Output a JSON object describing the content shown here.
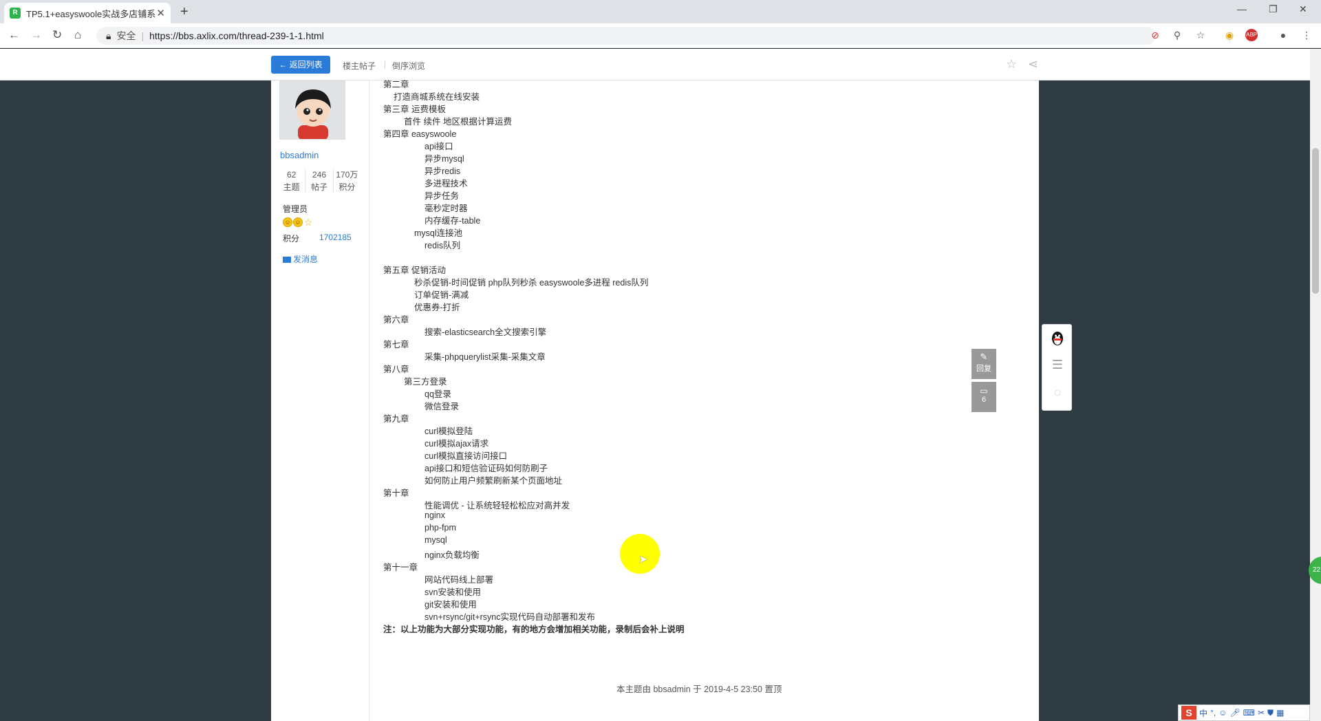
{
  "browser": {
    "tab_title": "TP5.1+easyswoole实战多店铺系",
    "tab_close": "✕",
    "new_tab": "+",
    "security_label": "安全",
    "url": "https://bbs.axlix.com/thread-239-1-1.html",
    "window_minimize": "—",
    "window_restore": "❐",
    "window_close": "✕"
  },
  "header": {
    "back_button": "返回列表",
    "owner_posts": "楼主帖子",
    "reverse_browse": "倒序浏览"
  },
  "author": {
    "username": "bbsadmin",
    "stats": [
      {
        "value": "62",
        "label": "主题"
      },
      {
        "value": "246",
        "label": "帖子"
      },
      {
        "value": "170万",
        "label": "积分"
      }
    ],
    "role": "管理员",
    "points_label": "积分",
    "points_value": "1702185",
    "send_message": "发消息"
  },
  "post": {
    "lines": [
      {
        "text": "第二章",
        "indent": 0
      },
      {
        "text": "打造商城系统在线安装",
        "indent": 1
      },
      {
        "text": "第三章 运费模板",
        "indent": 0
      },
      {
        "text": "首件 续件 地区根据计算运费",
        "indent": 2
      },
      {
        "text": "第四章  easyswoole",
        "indent": 0
      },
      {
        "text": "api接口",
        "indent": 4
      },
      {
        "text": "异步mysql",
        "indent": 4
      },
      {
        "text": "异步redis",
        "indent": 4
      },
      {
        "text": "多进程技术",
        "indent": 4
      },
      {
        "text": "异步任务",
        "indent": 4
      },
      {
        "text": "毫秒定时器",
        "indent": 4
      },
      {
        "text": "内存缓存-table",
        "indent": 4
      },
      {
        "text": "mysql连接池",
        "indent": 3
      },
      {
        "text": "redis队列",
        "indent": 4
      },
      {
        "text": "",
        "indent": 0
      },
      {
        "text": "第五章 促销活动",
        "indent": 0
      },
      {
        "text": "秒杀促销-时间促销 php队列秒杀  easyswoole多进程 redis队列",
        "indent": 3
      },
      {
        "text": "订单促销-满减",
        "indent": 3
      },
      {
        "text": "优惠券-打折",
        "indent": 3
      },
      {
        "text": "第六章",
        "indent": 0
      },
      {
        "text": "搜索-elasticsearch全文搜索引擎",
        "indent": 4
      },
      {
        "text": "第七章",
        "indent": 0
      },
      {
        "text": "采集-phpquerylist采集-采集文章",
        "indent": 4
      },
      {
        "text": "第八章",
        "indent": 0
      },
      {
        "text": "第三方登录",
        "indent": 2
      },
      {
        "text": "qq登录",
        "indent": 4
      },
      {
        "text": "微信登录",
        "indent": 4
      },
      {
        "text": "第九章",
        "indent": 0
      },
      {
        "text": "curl模拟登陆",
        "indent": 4
      },
      {
        "text": "curl模拟ajax请求",
        "indent": 4
      },
      {
        "text": "curl模拟直接访问接口",
        "indent": 4
      },
      {
        "text": "api接口和短信验证码如何防刷子",
        "indent": 4
      },
      {
        "text": "如何防止用户频繁刷新某个页面地址",
        "indent": 4
      },
      {
        "text": "第十章",
        "indent": 0
      },
      {
        "text": "性能调优 - 让系统轻轻松松应对高并发",
        "indent": 4
      },
      {
        "text": "nginx",
        "indent": 4
      },
      {
        "text": "php-fpm",
        "indent": 4
      },
      {
        "text": "mysql",
        "indent": 4
      },
      {
        "text": "nginx负载均衡",
        "indent": 4
      },
      {
        "text": "第十一章",
        "indent": 0
      },
      {
        "text": "网站代码线上部署",
        "indent": 4
      },
      {
        "text": "svn安装和使用",
        "indent": 4
      },
      {
        "text": "git安装和使用",
        "indent": 4
      },
      {
        "text": "svn+rsync/git+rsync实现代码自动部署和发布",
        "indent": 4
      },
      {
        "text": "注：以上功能为大部分实现功能，有的地方会增加相关功能，录制后会补上说明",
        "indent": 0,
        "bold": true
      }
    ],
    "footer_note": "本主题由 bbsadmin 于 2019-4-5 23:50 置顶"
  },
  "floating": {
    "reply_label": "回复",
    "comment_count": "6",
    "green_badge": "22"
  },
  "ime": {
    "logo": "S",
    "mode": "中"
  },
  "colors": {
    "accent": "#2b7bd9",
    "page_bg": "#2f3b43",
    "cursor_highlight": "#ffff00"
  }
}
